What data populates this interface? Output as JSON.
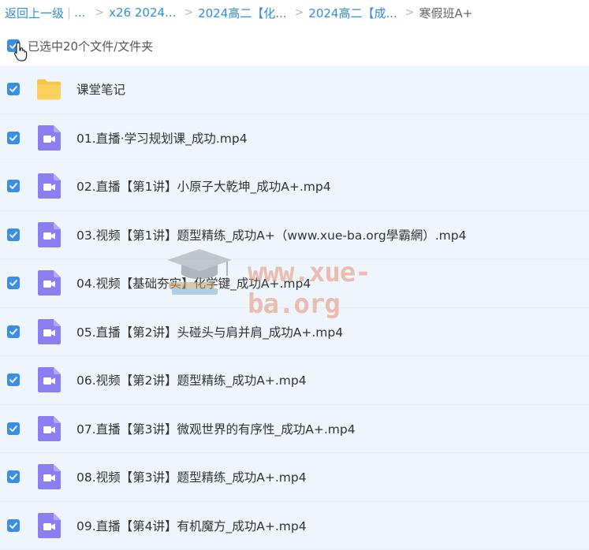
{
  "breadcrumb": {
    "back": "返回上一级",
    "more": "...",
    "items": [
      "x26 2024...",
      "2024高二【化...",
      "2024高二【成..."
    ],
    "current": "寒假班A+"
  },
  "selection": {
    "text": "已选中20个文件/文件夹"
  },
  "files": [
    {
      "name": "课堂笔记",
      "type": "folder"
    },
    {
      "name": "01.直播·学习规划课_成功.mp4",
      "type": "video"
    },
    {
      "name": "02.直播【第1讲】小原子大乾坤_成功A+.mp4",
      "type": "video"
    },
    {
      "name": "03.视频【第1讲】题型精练_成功A+（www.xue-ba.org學霸網）.mp4",
      "type": "video"
    },
    {
      "name": "04.视频【基础夯实】化学键_成功A+.mp4",
      "type": "video"
    },
    {
      "name": "05.直播【第2讲】头碰头与肩并肩_成功A+.mp4",
      "type": "video"
    },
    {
      "name": "06.视频【第2讲】题型精练_成功A+.mp4",
      "type": "video"
    },
    {
      "name": "07.直播【第3讲】微观世界的有序性_成功A+.mp4",
      "type": "video"
    },
    {
      "name": "08.视频【第3讲】题型精练_成功A+.mp4",
      "type": "video"
    },
    {
      "name": "09.直播【第4讲】有机魔方_成功A+.mp4",
      "type": "video"
    }
  ],
  "watermark": "www.xue-ba.org",
  "colors": {
    "accent": "#3a8ee6",
    "row_bg": "#eef5fd",
    "video_icon": "#8b7ef0",
    "folder": "#f7c948"
  },
  "icons": {
    "checkbox": "checkbox-checked-icon",
    "folder": "folder-icon",
    "video": "video-file-icon",
    "cursor": "hand-cursor-icon"
  }
}
